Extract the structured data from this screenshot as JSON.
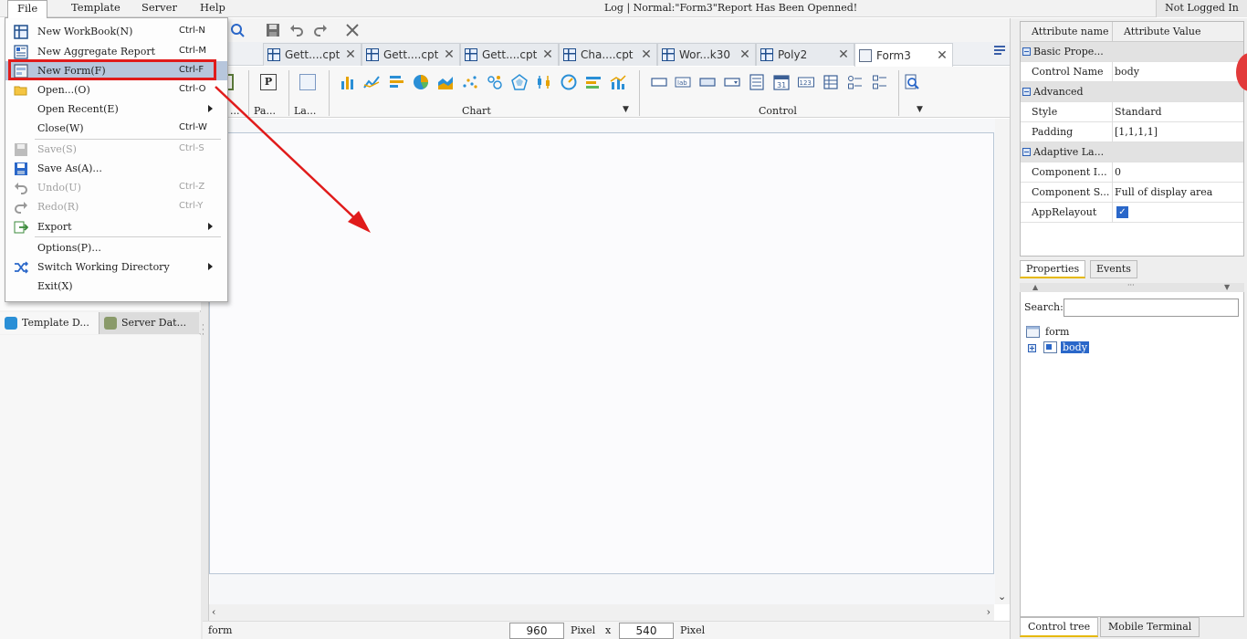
{
  "menubar": {
    "items": [
      "File",
      "Template",
      "Server",
      "Help"
    ],
    "log_text": "Log | Normal:\"Form3\"Report Has Been Openned!",
    "login_status": "Not Logged In"
  },
  "file_menu": {
    "items": [
      {
        "label": "New WorkBook(N)",
        "shortcut": "Ctrl-N",
        "icon": "workbook-icon"
      },
      {
        "label": "New Aggregate Report",
        "shortcut": "Ctrl-M",
        "icon": "aggregate-report-icon"
      },
      {
        "label": "New Form(F)",
        "shortcut": "Ctrl-F",
        "icon": "form-icon"
      },
      {
        "label": "Open...(O)",
        "shortcut": "Ctrl-O",
        "icon": "folder-open-icon"
      },
      {
        "label": "Open Recent(E)",
        "shortcut": "",
        "icon": ""
      },
      {
        "label": "Close(W)",
        "shortcut": "Ctrl-W",
        "icon": ""
      },
      {
        "label": "Save(S)",
        "shortcut": "Ctrl-S",
        "icon": "save-icon"
      },
      {
        "label": "Save As(A)...",
        "shortcut": "",
        "icon": "save-as-icon"
      },
      {
        "label": "Undo(U)",
        "shortcut": "Ctrl-Z",
        "icon": "undo-icon"
      },
      {
        "label": "Redo(R)",
        "shortcut": "Ctrl-Y",
        "icon": "redo-icon"
      },
      {
        "label": "Export",
        "shortcut": "",
        "icon": "export-icon"
      },
      {
        "label": "Options(P)...",
        "shortcut": "",
        "icon": ""
      },
      {
        "label": "Switch Working Directory",
        "shortcut": "",
        "icon": "switch-directory-icon"
      },
      {
        "label": "Exit(X)",
        "shortcut": "",
        "icon": ""
      }
    ]
  },
  "tabs": [
    {
      "label": "Gett....cpt"
    },
    {
      "label": "Gett....cpt"
    },
    {
      "label": "Gett....cpt"
    },
    {
      "label": "Cha....cpt"
    },
    {
      "label": "Wor...k30"
    },
    {
      "label": "Poly2"
    },
    {
      "label": "Form3"
    }
  ],
  "ribbon": {
    "groups": [
      "...",
      "Pa...",
      "La...",
      "Chart",
      "Control"
    ],
    "param_glyph": "P"
  },
  "left_panel": {
    "tabs": [
      "Template D...",
      "Server Dat..."
    ]
  },
  "statusbar": {
    "name": "form",
    "width": "960",
    "height": "540",
    "unit": "Pixel",
    "times": "x"
  },
  "properties": {
    "header": {
      "name": "Attribute name",
      "value": "Attribute Value"
    },
    "groups": [
      "Basic Prope...",
      "Advanced",
      "Adaptive La..."
    ],
    "rows": {
      "control_name": {
        "name": "Control Name",
        "value": "body"
      },
      "style": {
        "name": "Style",
        "value": "Standard"
      },
      "padding": {
        "name": "Padding",
        "value": "[1,1,1,1]"
      },
      "component_i": {
        "name": "Component I...",
        "value": "0"
      },
      "component_s": {
        "name": "Component S...",
        "value": "Full of display area"
      },
      "apprelayout": {
        "name": "AppRelayout",
        "checked": true,
        "check_glyph": "✓"
      }
    },
    "tabs": [
      "Properties",
      "Events"
    ]
  },
  "control_tree": {
    "search_label": "Search:",
    "search_value": "",
    "nodes": [
      "form",
      "body"
    ],
    "tabs": [
      "Control tree",
      "Mobile Terminal"
    ]
  },
  "colors": {
    "highlight": "#e01b1b",
    "selection": "#2a67c9",
    "menu_hover": "#b7c6dc"
  }
}
